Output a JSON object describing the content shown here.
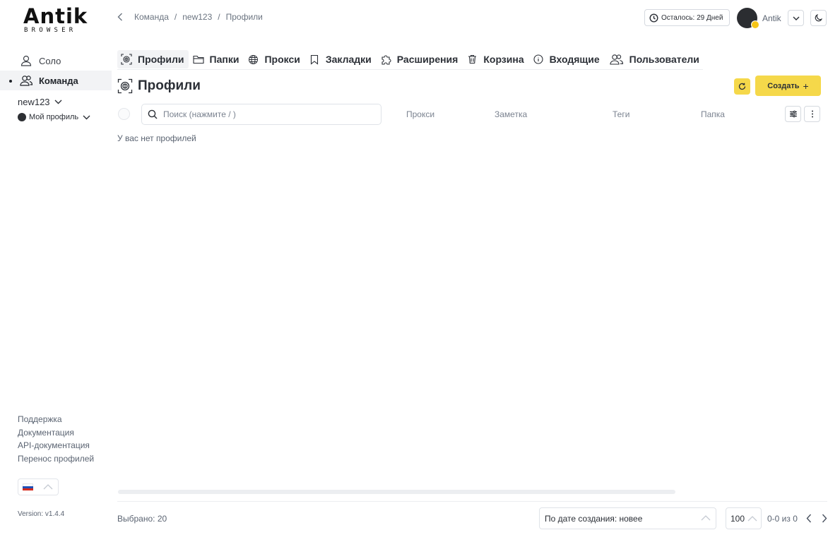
{
  "brand": {
    "logo_word": "Antik",
    "logo_sub": "BROWSER"
  },
  "sidebar": {
    "items": [
      {
        "label": "Соло",
        "icon": "user-icon"
      },
      {
        "label": "Команда",
        "icon": "users-icon",
        "active": true
      }
    ],
    "team": "new123",
    "profile": "Мой профиль",
    "links": [
      "Поддержка",
      "Документация",
      "API-документация",
      "Перенос профилей"
    ],
    "language": {
      "flag": "russian-flag-icon",
      "colors": [
        "#ffffff",
        "#1f4fb5",
        "#d52b1e"
      ]
    },
    "version": "Version: v1.4.4"
  },
  "header": {
    "breadcrumb": [
      "Команда",
      "new123",
      "Профили"
    ],
    "days_left": "Осталось: 29 Дней",
    "username": "Antik"
  },
  "tabs": [
    {
      "label": "Профили",
      "icon": "fingerprint-icon",
      "active": true
    },
    {
      "label": "Папки",
      "icon": "folder-icon"
    },
    {
      "label": "Прокси",
      "icon": "globe-icon"
    },
    {
      "label": "Закладки",
      "icon": "bookmark-icon"
    },
    {
      "label": "Расширения",
      "icon": "puzzle-icon"
    },
    {
      "label": "Корзина",
      "icon": "trash-icon"
    },
    {
      "label": "Входящие",
      "icon": "info-icon"
    },
    {
      "label": "Пользователи",
      "icon": "users-icon"
    }
  ],
  "main": {
    "title": "Профили",
    "create_label": "Создать",
    "search_placeholder": "Поиск (нажмите / )",
    "columns": [
      "Прокси",
      "Заметка",
      "Теги",
      "Папка"
    ],
    "empty_text": "У вас нет профилей"
  },
  "footer": {
    "selected": "Выбрано: 20",
    "sort": "По дате создания: новее",
    "per_page": "100",
    "range": "0-0 из 0"
  },
  "colors": {
    "accent": "#f5d84a",
    "active_bg": "#f2f3f5"
  }
}
